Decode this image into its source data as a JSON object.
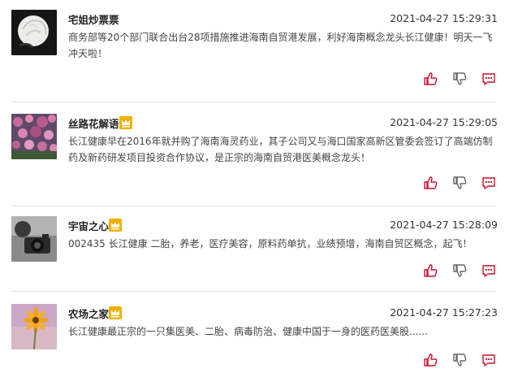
{
  "colors": {
    "accent": "#c8102e",
    "vip_badge": "#f0b000",
    "divider": "#e4e4e4"
  },
  "icons": {
    "like": "thumbs-up-icon",
    "dislike": "thumbs-down-icon",
    "reply": "comment-icon",
    "vip": "crown-icon"
  },
  "comments": [
    {
      "username": "宅姐炒票票",
      "vip": false,
      "time": "2021-04-27 15:29:31",
      "text": "商务部等20个部门联合出台28项措施推进海南自贸港发展，利好海南概念龙头长江健康！明天一飞冲天啦！"
    },
    {
      "username": "丝路花解语",
      "vip": true,
      "time": "2021-04-27 15:29:05",
      "text": "长江健康早在2016年就并购了海南海灵药业，其子公司又与海口国家高新区管委会签订了高端仿制药及新药研发项目投资合作协议，是正宗的海南自贸港医美概念龙头！"
    },
    {
      "username": "宇宙之心",
      "vip": true,
      "time": "2021-04-27 15:28:09",
      "text": "002435 长江健康 二胎，养老，医疗美容，原料药单抗，业绩预增，海南自贸区概念，起飞！"
    },
    {
      "username": "农场之家",
      "vip": true,
      "time": "2021-04-27 15:27:23",
      "text": "长江健康最正宗的一只集医美、二胎、病毒防治、健康中国于一身的医药医美股......"
    }
  ]
}
